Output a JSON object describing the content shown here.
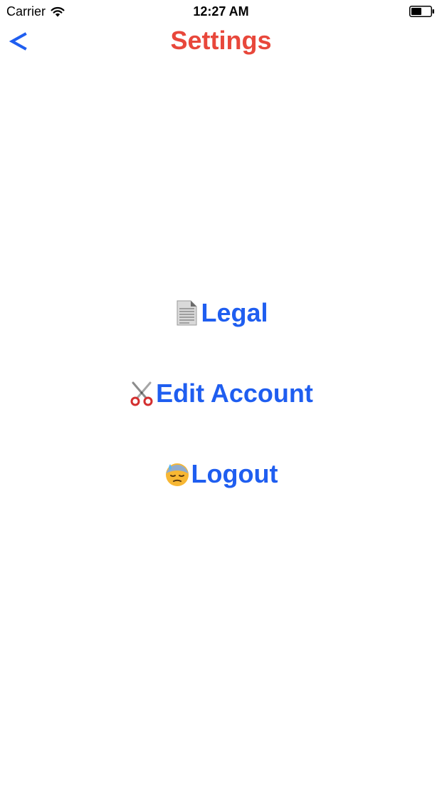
{
  "status_bar": {
    "carrier": "Carrier",
    "time": "12:27 AM",
    "icons": [
      "wifi-icon",
      "battery-icon"
    ]
  },
  "nav": {
    "back_label": "<",
    "title": "Settings"
  },
  "menu": {
    "items": [
      {
        "label": "Legal",
        "icon": "document-icon"
      },
      {
        "label": "Edit Account",
        "icon": "scissors-icon"
      },
      {
        "label": "Logout",
        "icon": "downcast-sweat-face-icon"
      }
    ]
  },
  "colors": {
    "title": "#E8473B",
    "accent": "#1F5EF0",
    "background": "#FFFFFF"
  }
}
